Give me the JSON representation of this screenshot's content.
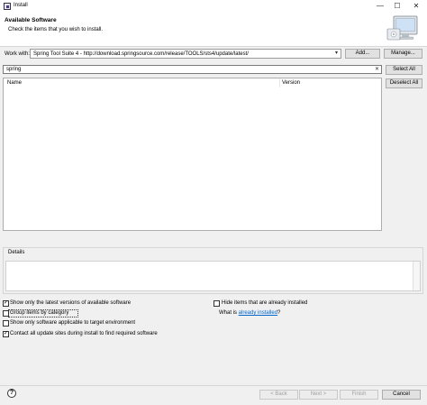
{
  "window": {
    "title": "Install",
    "minimize": "—",
    "maximize": "☐",
    "close": "✕"
  },
  "header": {
    "title": "Available Software",
    "subtitle": "Check the items that you wish to install."
  },
  "work_with": {
    "label": "Work with:",
    "value": "Spring Tool Suite 4 - http://download.springsource.com/release/TOOLS/sts4/update/latest/",
    "add_label": "Add...",
    "manage_label": "Manage..."
  },
  "filter": {
    "value": "spring",
    "clear_icon": "clear-icon"
  },
  "selection": {
    "select_all": "Select All",
    "deselect_all": "Deselect All"
  },
  "table": {
    "columns": [
      "Name",
      "Version"
    ],
    "rows": []
  },
  "details": {
    "label": "Details",
    "text": ""
  },
  "options": {
    "latest_versions": {
      "label": "Show only the latest versions of available software",
      "checked": true
    },
    "group_by_category": {
      "label": "Group items by category",
      "checked": false
    },
    "applicable_only": {
      "label": "Show only software applicable to target environment",
      "checked": false
    },
    "contact_sites": {
      "label": "Contact all update sites during install to find required software",
      "checked": true
    },
    "hide_installed": {
      "label": "Hide items that are already installed",
      "checked": false
    },
    "what_is_prefix": "What is ",
    "already_installed_link": "already installed",
    "what_is_suffix": "?"
  },
  "footer": {
    "help": "?",
    "back": "< Back",
    "next": "Next >",
    "finish": "Finish",
    "cancel": "Cancel"
  }
}
